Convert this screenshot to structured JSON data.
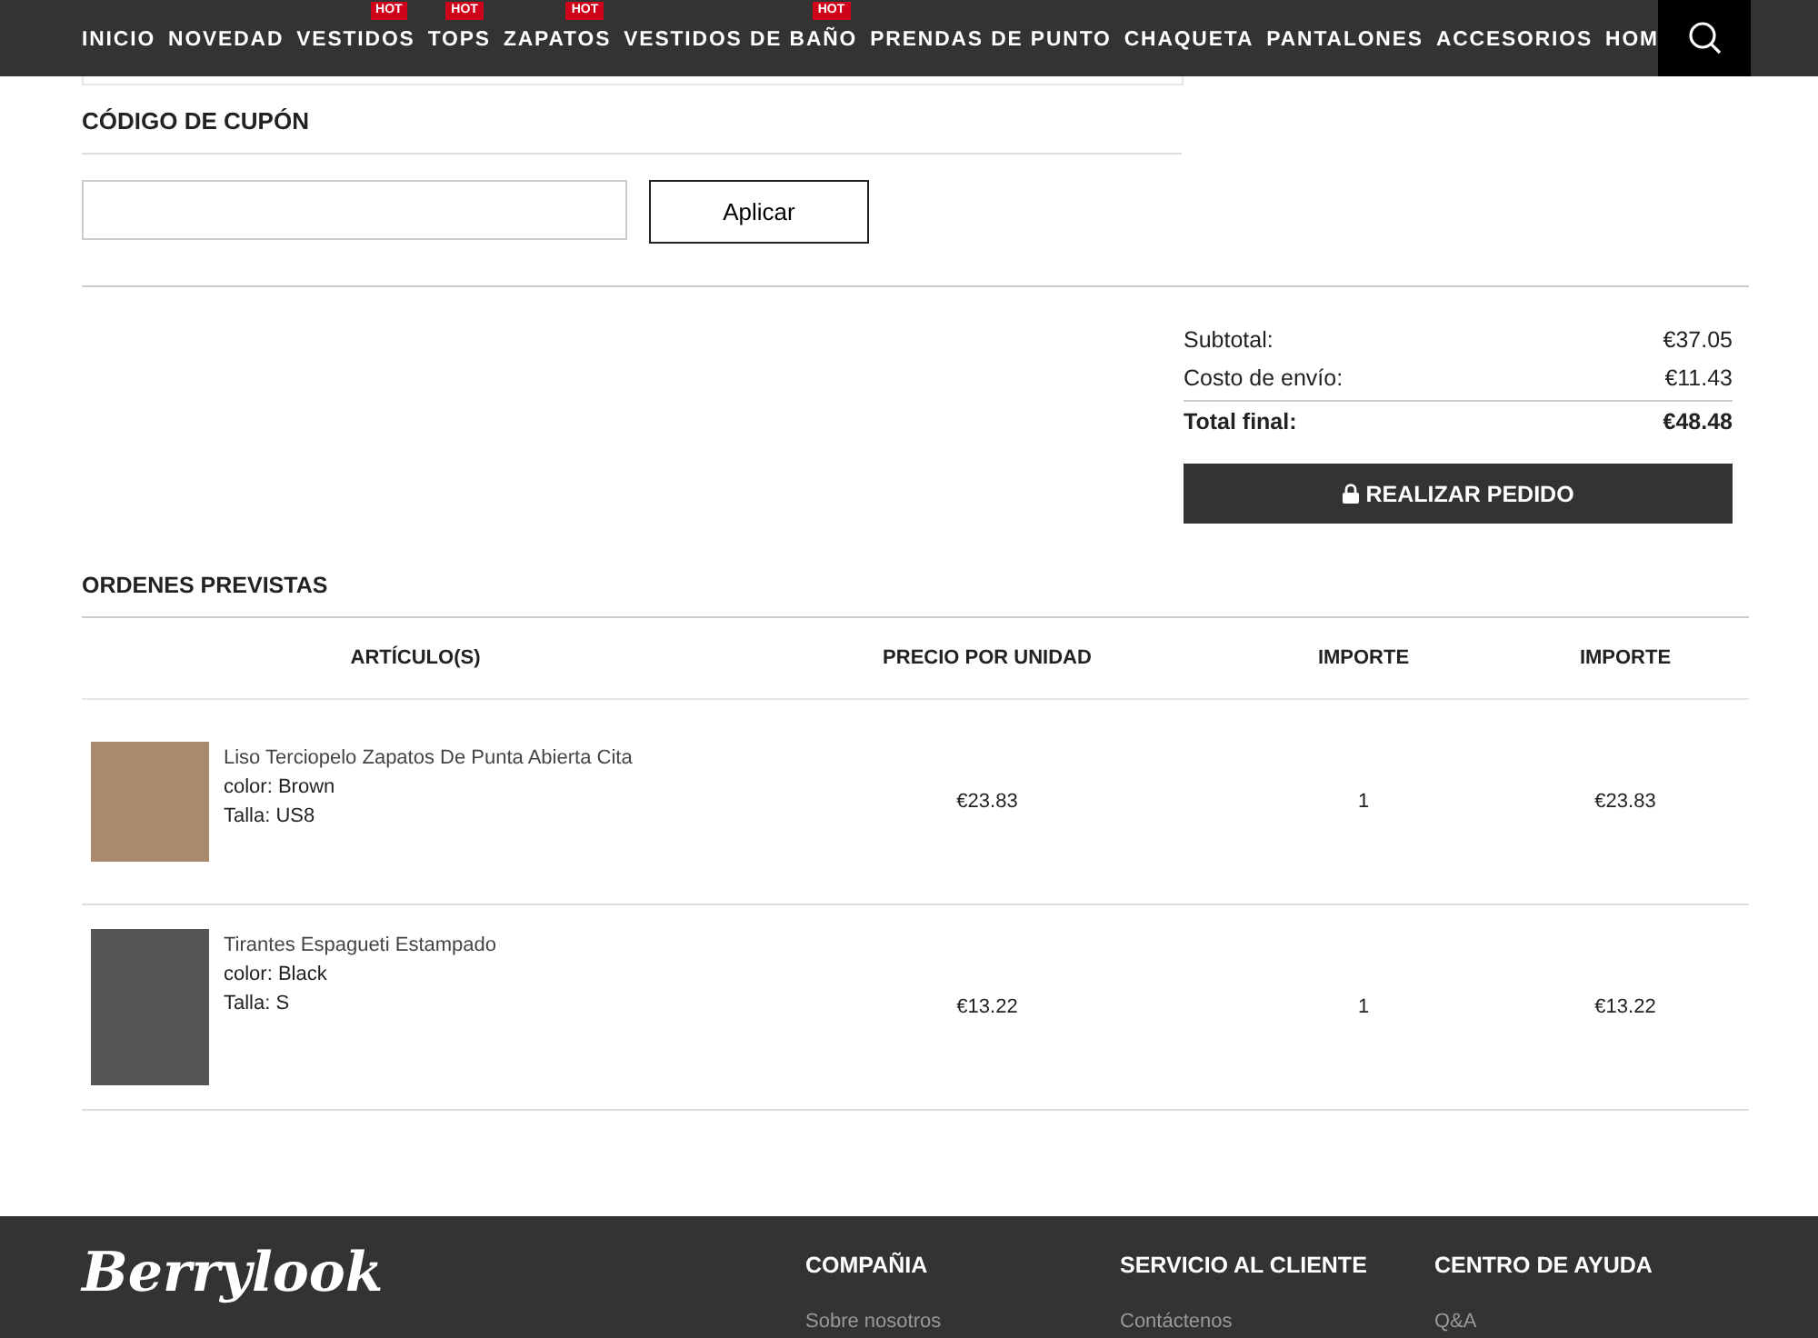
{
  "nav": {
    "items": [
      {
        "label": "INICIO",
        "hot": false
      },
      {
        "label": "NOVEDAD",
        "hot": false
      },
      {
        "label": "VESTIDOS",
        "hot": true,
        "badge": "HOT"
      },
      {
        "label": "TOPS",
        "hot": true,
        "badge": "HOT"
      },
      {
        "label": "ZAPATOS",
        "hot": true,
        "badge": "HOT"
      },
      {
        "label": "VESTIDOS DE BAÑO",
        "hot": true,
        "badge": "HOT"
      },
      {
        "label": "PRENDAS DE PUNTO",
        "hot": false
      },
      {
        "label": "CHAQUETA",
        "hot": false
      },
      {
        "label": "PANTALONES",
        "hot": false
      },
      {
        "label": "ACCESORIOS",
        "hot": false
      },
      {
        "label": "HOM",
        "hot": false
      }
    ]
  },
  "coupon": {
    "title": "CÓDIGO DE CUPÓN",
    "button": "Aplicar"
  },
  "summary": {
    "rows": [
      {
        "label": "Subtotal:",
        "value": "€37.05",
        "bold": false
      },
      {
        "label": "Costo de envío:",
        "value": "€11.43",
        "bold": false
      },
      {
        "label": "Total final:",
        "value": "€48.48",
        "bold": true
      }
    ],
    "button": "REALIZAR PEDIDO"
  },
  "orders": {
    "title": "ORDENES PREVISTAS",
    "columns": [
      "ARTÍCULO(S)",
      "PRECIO POR UNIDAD",
      "IMPORTE",
      "IMPORTE"
    ],
    "rows": [
      {
        "name": "Liso Terciopelo Zapatos De Punta Abierta Cita",
        "color_text": "color: Brown",
        "size": "Talla: US8",
        "price": "€23.83",
        "qty": "1",
        "total": "€23.83"
      },
      {
        "name": "Tirantes Espagueti Estampado",
        "color_text": "color: Black",
        "size": "Talla: S",
        "price": "€13.22",
        "qty": "1",
        "total": "€13.22"
      }
    ]
  },
  "footer": {
    "logo": "Berrylook",
    "columns": [
      {
        "title": "COMPAÑIA",
        "link": "Sobre nosotros"
      },
      {
        "title": "SERVICIO AL CLIENTE",
        "link": "Contáctenos"
      },
      {
        "title": "CENTRO DE AYUDA",
        "link": "Q&A"
      }
    ]
  }
}
